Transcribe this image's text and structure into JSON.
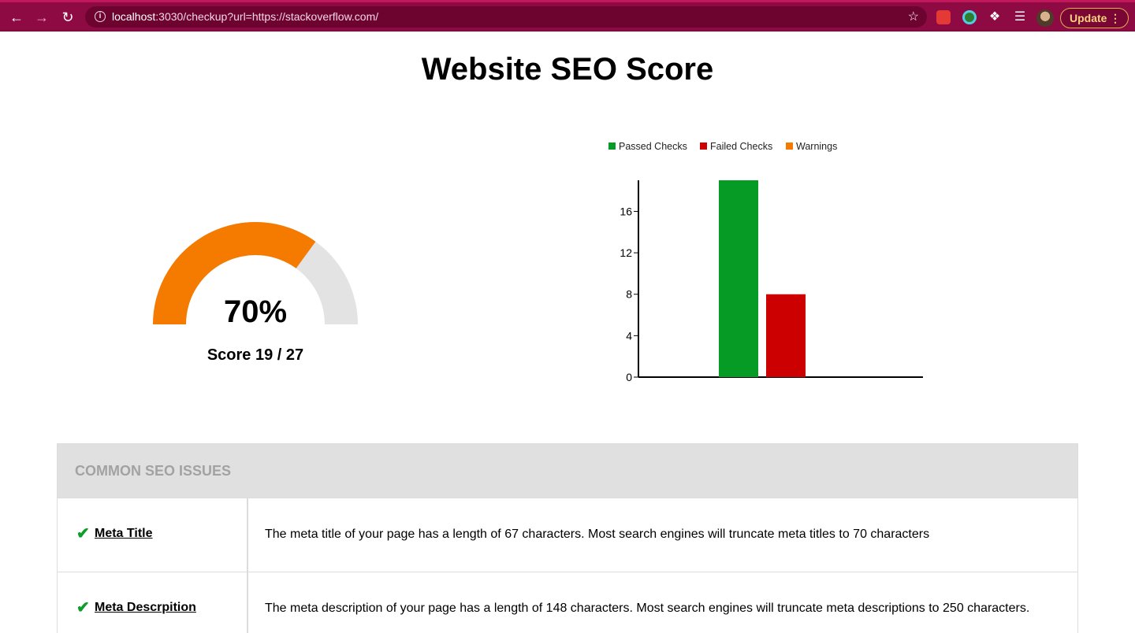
{
  "browser": {
    "url_host": "localhost",
    "url_rest": ":3030/checkup?url=https://stackoverflow.com/",
    "update_label": "Update"
  },
  "page": {
    "title": "Website SEO Score"
  },
  "gauge": {
    "percent_text": "70%",
    "score_text": "Score 19 / 27",
    "fraction": 0.7,
    "colors": {
      "filled": "#f57a00",
      "empty": "#e3e3e3"
    }
  },
  "chart_data": {
    "type": "bar",
    "legend_position": "top",
    "series": [
      {
        "name": "Passed Checks",
        "value": 19,
        "color": "#069b24"
      },
      {
        "name": "Failed Checks",
        "value": 8,
        "color": "#cc0000"
      },
      {
        "name": "Warnings",
        "value": 0,
        "color": "#f57a00"
      }
    ],
    "y_ticks": [
      0,
      4,
      8,
      12,
      16
    ],
    "ylim": [
      0,
      19
    ],
    "grid": false
  },
  "issues": {
    "header": "COMMON SEO ISSUES",
    "rows": [
      {
        "name": "Meta Title",
        "status": "passed",
        "description": "The meta title of your page has a length of 67 characters. Most search engines will truncate meta titles to 70 characters"
      },
      {
        "name": "Meta Descrpition",
        "status": "passed",
        "description": "The meta description of your page has a length of 148 characters. Most search engines will truncate meta descriptions to 250 characters."
      }
    ]
  }
}
